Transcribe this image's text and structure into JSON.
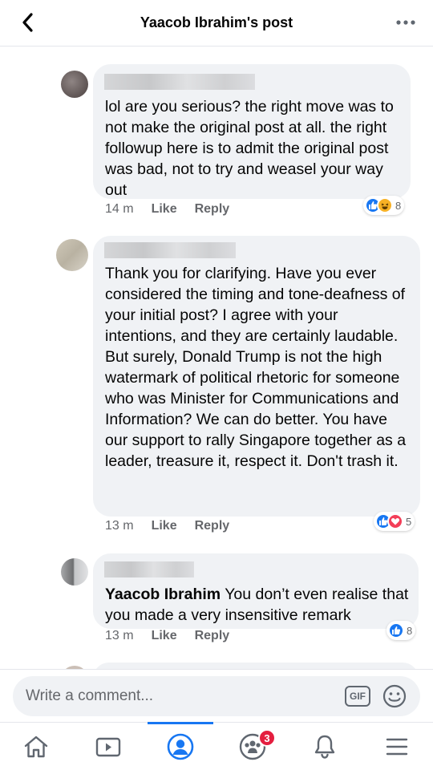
{
  "header": {
    "title": "Yaacob Ibrahim's post"
  },
  "comments": [
    {
      "text": "lol are you serious? the right move was to not make the original post at all. the right followup here is to admit the original post was bad, not to try and weasel your way out",
      "time": "14 m",
      "like_label": "Like",
      "reply_label": "Reply",
      "reaction_types": [
        "like",
        "haha"
      ],
      "reaction_count": "8"
    },
    {
      "text": "Thank you for clarifying. Have you ever considered the timing and tone-deafness of your initial post? I agree with your intentions, and they are certainly laudable. But surely, Donald Trump is not the high watermark of political rhetoric for someone who was Minister for Communications and Information? We can do better. You have our support to rally Singapore together as a leader, treasure it, respect it. Don't trash it.",
      "time": "13 m",
      "like_label": "Like",
      "reply_label": "Reply",
      "reaction_types": [
        "like",
        "love"
      ],
      "reaction_count": "5"
    },
    {
      "mention": "Yaacob Ibrahim",
      "text": "You don’t even realise that you made a very insensitive remark",
      "time": "13 m",
      "like_label": "Like",
      "reply_label": "Reply",
      "reaction_types": [
        "like"
      ],
      "reaction_count": "8"
    }
  ],
  "composer": {
    "placeholder": "Write a comment...",
    "gif_label": "GIF"
  },
  "tabbar": {
    "tabs": [
      "home-icon",
      "watch-icon",
      "profile-icon",
      "groups-icon",
      "notifications-icon",
      "menu-icon"
    ],
    "active": "profile-icon",
    "groups_badge": "3"
  },
  "colors": {
    "accent": "#1877f2",
    "love": "#f33e58",
    "haha": "#f7b125",
    "badge": "#e41e3f",
    "bubble": "#f0f2f5"
  }
}
